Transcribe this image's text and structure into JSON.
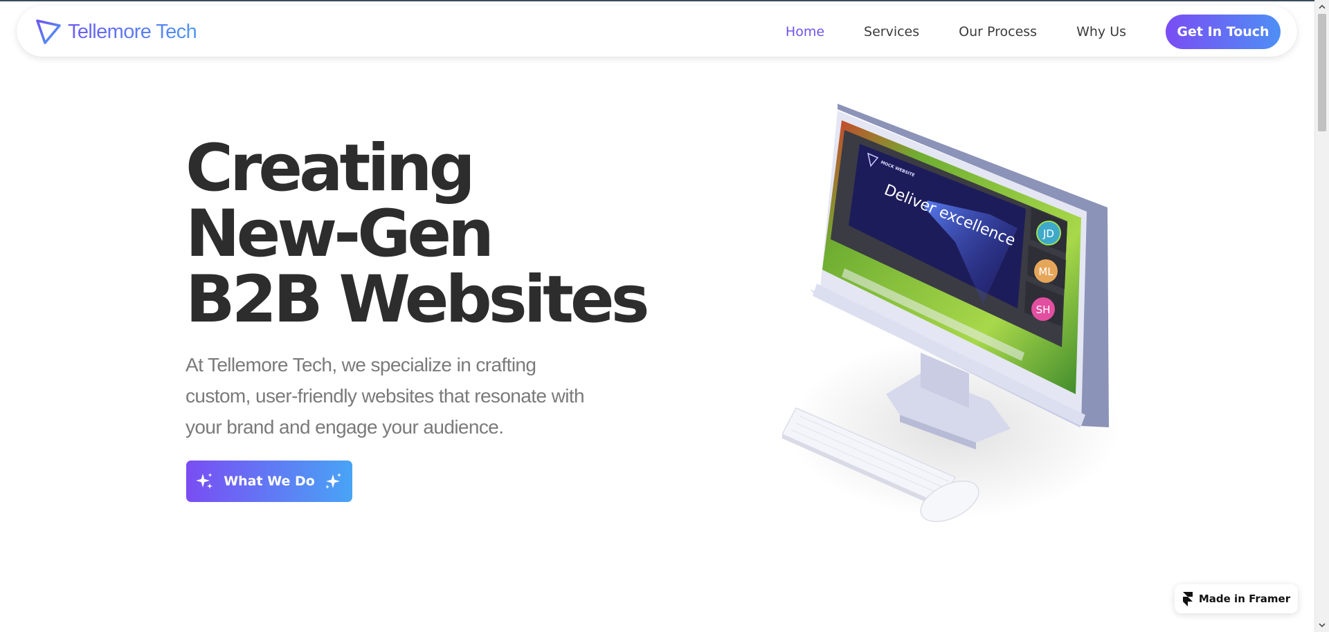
{
  "nav": {
    "brand": "Tellemore Tech",
    "links": [
      "Home",
      "Services",
      "Our Process",
      "Why Us"
    ],
    "active": "Home",
    "cta": "Get In Touch"
  },
  "hero": {
    "title_lines": [
      "Creating",
      "New-Gen",
      "B2B Websites"
    ],
    "description": "At Tellemore Tech, we specialize in crafting custom, user-friendly websites that resonate with your brand and engage your audience.",
    "cta": "What We Do"
  },
  "illustration": {
    "screen_heading": "Deliver excellence",
    "screen_logo": "MOCK WEBSITE",
    "participants": [
      "JD",
      "ML",
      "SH"
    ]
  },
  "badge": {
    "label": "Made in Framer"
  },
  "colors": {
    "accent_purple": "#7a4df3",
    "accent_blue": "#4e8ff5",
    "heading": "#2d2d2d",
    "body": "#7a7a7a"
  }
}
